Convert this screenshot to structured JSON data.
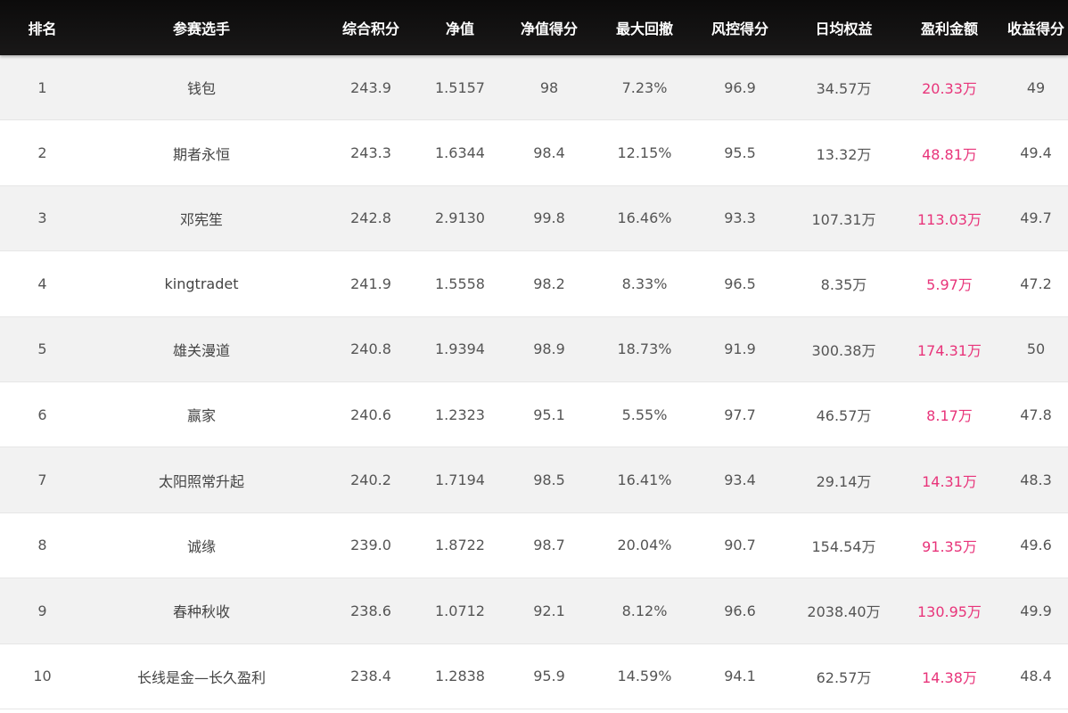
{
  "columns": [
    "排名",
    "参赛选手",
    "综合积分",
    "净值",
    "净值得分",
    "最大回撤",
    "风控得分",
    "日均权益",
    "盈利金额",
    "收益得分"
  ],
  "colors": {
    "profit": "#e8347a",
    "header_bg": "#111010",
    "row_alt": "#f2f2f2"
  },
  "rows": [
    [
      "1",
      "钱包",
      "243.9",
      "1.5157",
      "98",
      "7.23%",
      "96.9",
      "34.57万",
      "20.33万",
      "49"
    ],
    [
      "2",
      "期者永恒",
      "243.3",
      "1.6344",
      "98.4",
      "12.15%",
      "95.5",
      "13.32万",
      "48.81万",
      "49.4"
    ],
    [
      "3",
      "邓宪笙",
      "242.8",
      "2.9130",
      "99.8",
      "16.46%",
      "93.3",
      "107.31万",
      "113.03万",
      "49.7"
    ],
    [
      "4",
      "kingtradet",
      "241.9",
      "1.5558",
      "98.2",
      "8.33%",
      "96.5",
      "8.35万",
      "5.97万",
      "47.2"
    ],
    [
      "5",
      "雄关漫道",
      "240.8",
      "1.9394",
      "98.9",
      "18.73%",
      "91.9",
      "300.38万",
      "174.31万",
      "50"
    ],
    [
      "6",
      "赢家",
      "240.6",
      "1.2323",
      "95.1",
      "5.55%",
      "97.7",
      "46.57万",
      "8.17万",
      "47.8"
    ],
    [
      "7",
      "太阳照常升起",
      "240.2",
      "1.7194",
      "98.5",
      "16.41%",
      "93.4",
      "29.14万",
      "14.31万",
      "48.3"
    ],
    [
      "8",
      "诚缘",
      "239.0",
      "1.8722",
      "98.7",
      "20.04%",
      "90.7",
      "154.54万",
      "91.35万",
      "49.6"
    ],
    [
      "9",
      "春种秋收",
      "238.6",
      "1.0712",
      "92.1",
      "8.12%",
      "96.6",
      "2038.40万",
      "130.95万",
      "49.9"
    ],
    [
      "10",
      "长线是金—长久盈利",
      "238.4",
      "1.2838",
      "95.9",
      "14.59%",
      "94.1",
      "62.57万",
      "14.38万",
      "48.4"
    ]
  ]
}
